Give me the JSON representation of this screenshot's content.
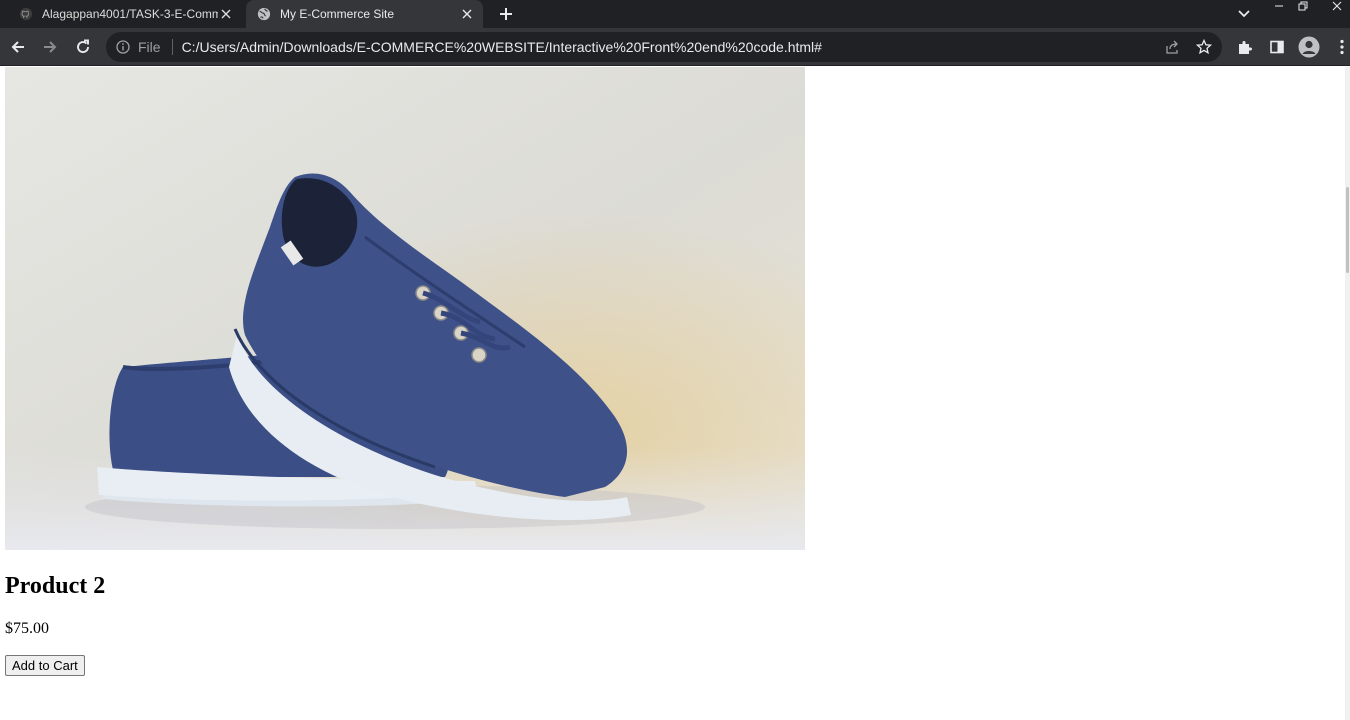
{
  "browser": {
    "tabs": [
      {
        "title": "Alagappan4001/TASK-3-E-Comm",
        "active": false,
        "icon": "github-icon"
      },
      {
        "title": "My E-Commerce Site",
        "active": true,
        "icon": "globe-icon"
      }
    ],
    "address_bar": {
      "scheme_label": "File",
      "url": "C:/Users/Admin/Downloads/E-COMMERCE%20WEBSITE/Interactive%20Front%20end%20code.html#"
    },
    "colors": {
      "tabstrip": "#202124",
      "toolbar": "#35363a",
      "omnibox": "#202124"
    }
  },
  "page": {
    "product": {
      "name": "Product 2",
      "price": "$75.00",
      "add_to_cart_label": "Add to Cart",
      "image": "blue-canvas-sneakers-photo"
    }
  }
}
